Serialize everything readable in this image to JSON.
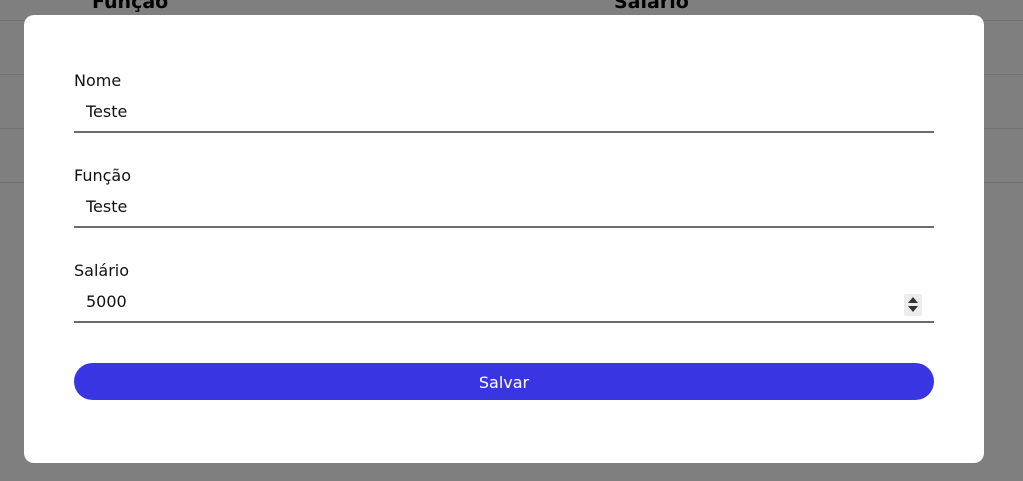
{
  "background_table": {
    "columns": [
      "Função",
      "Salário"
    ]
  },
  "form": {
    "fields": [
      {
        "label": "Nome",
        "value": "Teste"
      },
      {
        "label": "Função",
        "value": "Teste"
      },
      {
        "label": "Salário",
        "value": "5000"
      }
    ],
    "save_label": "Salvar"
  },
  "colors": {
    "primary_button": "#3a35e3",
    "overlay": "rgba(0,0,0,0.5)"
  }
}
